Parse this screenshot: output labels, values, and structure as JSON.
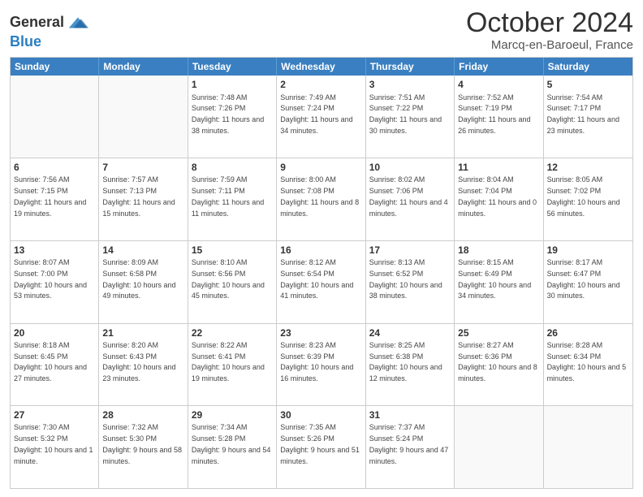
{
  "header": {
    "logo_line1": "General",
    "logo_line2": "Blue",
    "month_title": "October 2024",
    "location": "Marcq-en-Baroeul, France"
  },
  "days": [
    "Sunday",
    "Monday",
    "Tuesday",
    "Wednesday",
    "Thursday",
    "Friday",
    "Saturday"
  ],
  "weeks": [
    [
      {
        "day": "",
        "info": ""
      },
      {
        "day": "",
        "info": ""
      },
      {
        "day": "1",
        "info": "Sunrise: 7:48 AM\nSunset: 7:26 PM\nDaylight: 11 hours and 38 minutes."
      },
      {
        "day": "2",
        "info": "Sunrise: 7:49 AM\nSunset: 7:24 PM\nDaylight: 11 hours and 34 minutes."
      },
      {
        "day": "3",
        "info": "Sunrise: 7:51 AM\nSunset: 7:22 PM\nDaylight: 11 hours and 30 minutes."
      },
      {
        "day": "4",
        "info": "Sunrise: 7:52 AM\nSunset: 7:19 PM\nDaylight: 11 hours and 26 minutes."
      },
      {
        "day": "5",
        "info": "Sunrise: 7:54 AM\nSunset: 7:17 PM\nDaylight: 11 hours and 23 minutes."
      }
    ],
    [
      {
        "day": "6",
        "info": "Sunrise: 7:56 AM\nSunset: 7:15 PM\nDaylight: 11 hours and 19 minutes."
      },
      {
        "day": "7",
        "info": "Sunrise: 7:57 AM\nSunset: 7:13 PM\nDaylight: 11 hours and 15 minutes."
      },
      {
        "day": "8",
        "info": "Sunrise: 7:59 AM\nSunset: 7:11 PM\nDaylight: 11 hours and 11 minutes."
      },
      {
        "day": "9",
        "info": "Sunrise: 8:00 AM\nSunset: 7:08 PM\nDaylight: 11 hours and 8 minutes."
      },
      {
        "day": "10",
        "info": "Sunrise: 8:02 AM\nSunset: 7:06 PM\nDaylight: 11 hours and 4 minutes."
      },
      {
        "day": "11",
        "info": "Sunrise: 8:04 AM\nSunset: 7:04 PM\nDaylight: 11 hours and 0 minutes."
      },
      {
        "day": "12",
        "info": "Sunrise: 8:05 AM\nSunset: 7:02 PM\nDaylight: 10 hours and 56 minutes."
      }
    ],
    [
      {
        "day": "13",
        "info": "Sunrise: 8:07 AM\nSunset: 7:00 PM\nDaylight: 10 hours and 53 minutes."
      },
      {
        "day": "14",
        "info": "Sunrise: 8:09 AM\nSunset: 6:58 PM\nDaylight: 10 hours and 49 minutes."
      },
      {
        "day": "15",
        "info": "Sunrise: 8:10 AM\nSunset: 6:56 PM\nDaylight: 10 hours and 45 minutes."
      },
      {
        "day": "16",
        "info": "Sunrise: 8:12 AM\nSunset: 6:54 PM\nDaylight: 10 hours and 41 minutes."
      },
      {
        "day": "17",
        "info": "Sunrise: 8:13 AM\nSunset: 6:52 PM\nDaylight: 10 hours and 38 minutes."
      },
      {
        "day": "18",
        "info": "Sunrise: 8:15 AM\nSunset: 6:49 PM\nDaylight: 10 hours and 34 minutes."
      },
      {
        "day": "19",
        "info": "Sunrise: 8:17 AM\nSunset: 6:47 PM\nDaylight: 10 hours and 30 minutes."
      }
    ],
    [
      {
        "day": "20",
        "info": "Sunrise: 8:18 AM\nSunset: 6:45 PM\nDaylight: 10 hours and 27 minutes."
      },
      {
        "day": "21",
        "info": "Sunrise: 8:20 AM\nSunset: 6:43 PM\nDaylight: 10 hours and 23 minutes."
      },
      {
        "day": "22",
        "info": "Sunrise: 8:22 AM\nSunset: 6:41 PM\nDaylight: 10 hours and 19 minutes."
      },
      {
        "day": "23",
        "info": "Sunrise: 8:23 AM\nSunset: 6:39 PM\nDaylight: 10 hours and 16 minutes."
      },
      {
        "day": "24",
        "info": "Sunrise: 8:25 AM\nSunset: 6:38 PM\nDaylight: 10 hours and 12 minutes."
      },
      {
        "day": "25",
        "info": "Sunrise: 8:27 AM\nSunset: 6:36 PM\nDaylight: 10 hours and 8 minutes."
      },
      {
        "day": "26",
        "info": "Sunrise: 8:28 AM\nSunset: 6:34 PM\nDaylight: 10 hours and 5 minutes."
      }
    ],
    [
      {
        "day": "27",
        "info": "Sunrise: 7:30 AM\nSunset: 5:32 PM\nDaylight: 10 hours and 1 minute."
      },
      {
        "day": "28",
        "info": "Sunrise: 7:32 AM\nSunset: 5:30 PM\nDaylight: 9 hours and 58 minutes."
      },
      {
        "day": "29",
        "info": "Sunrise: 7:34 AM\nSunset: 5:28 PM\nDaylight: 9 hours and 54 minutes."
      },
      {
        "day": "30",
        "info": "Sunrise: 7:35 AM\nSunset: 5:26 PM\nDaylight: 9 hours and 51 minutes."
      },
      {
        "day": "31",
        "info": "Sunrise: 7:37 AM\nSunset: 5:24 PM\nDaylight: 9 hours and 47 minutes."
      },
      {
        "day": "",
        "info": ""
      },
      {
        "day": "",
        "info": ""
      }
    ]
  ]
}
